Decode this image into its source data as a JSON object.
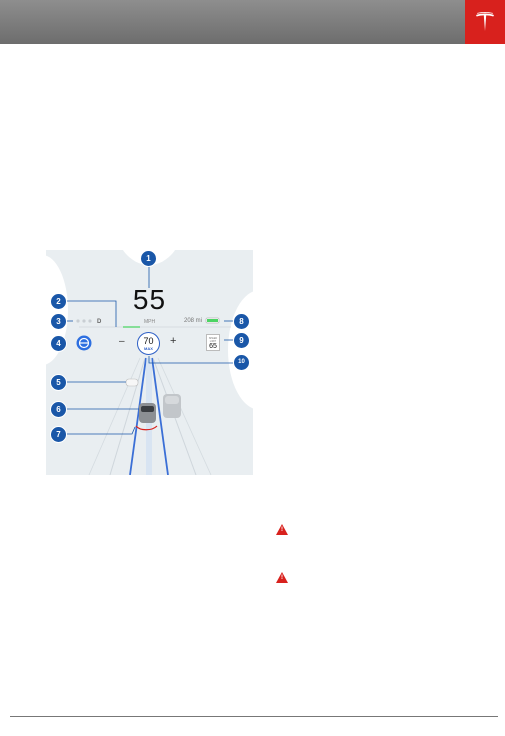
{
  "figure": {
    "speed": "55",
    "speed_unit": "MPH",
    "gear": "D",
    "range": "208 mi",
    "set_speed": "70",
    "set_speed_label": "MAX",
    "minus": "–",
    "plus": "+",
    "speed_limit_label": "SPEED LIMIT",
    "speed_limit": "65",
    "callouts": [
      "1",
      "2",
      "3",
      "4",
      "5",
      "6",
      "7",
      "8",
      "9",
      "10"
    ]
  },
  "warnings": [
    {
      "icon": "warning-triangle-icon",
      "glyph": "!"
    },
    {
      "icon": "warning-triangle-icon",
      "glyph": "!"
    }
  ],
  "colors": {
    "header": "#7a7a7a",
    "logo_bg": "#d8211d",
    "callout": "#1a57a8",
    "warning": "#d8211d"
  }
}
